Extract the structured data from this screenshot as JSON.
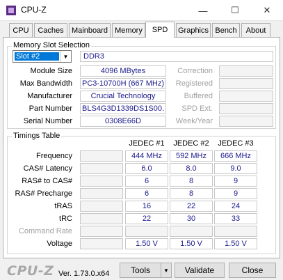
{
  "window": {
    "title": "CPU-Z",
    "minimize_glyph": "—",
    "maximize_glyph": "☐",
    "close_glyph": "✕"
  },
  "tabs": [
    "CPU",
    "Caches",
    "Mainboard",
    "Memory",
    "SPD",
    "Graphics",
    "Bench",
    "About"
  ],
  "active_tab": "SPD",
  "memory_slot": {
    "legend": "Memory Slot Selection",
    "selected_slot": "Slot #2",
    "memory_type": "DDR3",
    "fields": {
      "module_size_label": "Module Size",
      "module_size": "4096 MBytes",
      "max_bandwidth_label": "Max Bandwidth",
      "max_bandwidth": "PC3-10700H (667 MHz)",
      "manufacturer_label": "Manufacturer",
      "manufacturer": "Crucial Technology",
      "part_number_label": "Part Number",
      "part_number": "BLS4G3D1339DS1S00.",
      "serial_number_label": "Serial Number",
      "serial_number": "0308E66D",
      "correction_label": "Correction",
      "registered_label": "Registered",
      "buffered_label": "Buffered",
      "spd_ext_label": "SPD Ext.",
      "week_year_label": "Week/Year"
    }
  },
  "timings": {
    "legend": "Timings Table",
    "columns": [
      "JEDEC #1",
      "JEDEC #2",
      "JEDEC #3"
    ],
    "rows": [
      {
        "label": "Frequency",
        "values": [
          "444 MHz",
          "592 MHz",
          "666 MHz"
        ]
      },
      {
        "label": "CAS# Latency",
        "values": [
          "6.0",
          "8.0",
          "9.0"
        ]
      },
      {
        "label": "RAS# to CAS#",
        "values": [
          "6",
          "8",
          "9"
        ]
      },
      {
        "label": "RAS# Precharge",
        "values": [
          "6",
          "8",
          "9"
        ]
      },
      {
        "label": "tRAS",
        "values": [
          "16",
          "22",
          "24"
        ]
      },
      {
        "label": "tRC",
        "values": [
          "22",
          "30",
          "33"
        ]
      },
      {
        "label": "Command Rate",
        "values": [
          "",
          "",
          ""
        ]
      },
      {
        "label": "Voltage",
        "values": [
          "1.50 V",
          "1.50 V",
          "1.50 V"
        ]
      }
    ]
  },
  "footer": {
    "logo": "CPU-Z",
    "version": "Ver. 1.73.0.x64",
    "tools_label": "Tools",
    "validate_label": "Validate",
    "close_label": "Close"
  }
}
